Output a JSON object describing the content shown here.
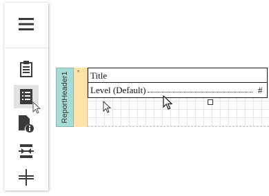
{
  "toolbar": {
    "items": [
      {
        "icon": "hamburger-menu-icon",
        "selected": false
      },
      {
        "icon": "clipboard-icon",
        "selected": false
      },
      {
        "icon": "document-list-icon",
        "selected": true
      },
      {
        "icon": "document-info-icon",
        "selected": false
      },
      {
        "icon": "insert-band-icon",
        "selected": false
      },
      {
        "icon": "vertical-separator-icon",
        "selected": false
      }
    ]
  },
  "designer": {
    "band_label": "ReportHeader1",
    "title_text": "Title",
    "level_text": "Level (Default)",
    "page_number_placeholder": "#"
  },
  "colors": {
    "band_strip": "#a7dbd6",
    "ruler_strip": "#fde3a6",
    "selected_button": "#e2e2e2",
    "icon": "#3a3a3a"
  }
}
